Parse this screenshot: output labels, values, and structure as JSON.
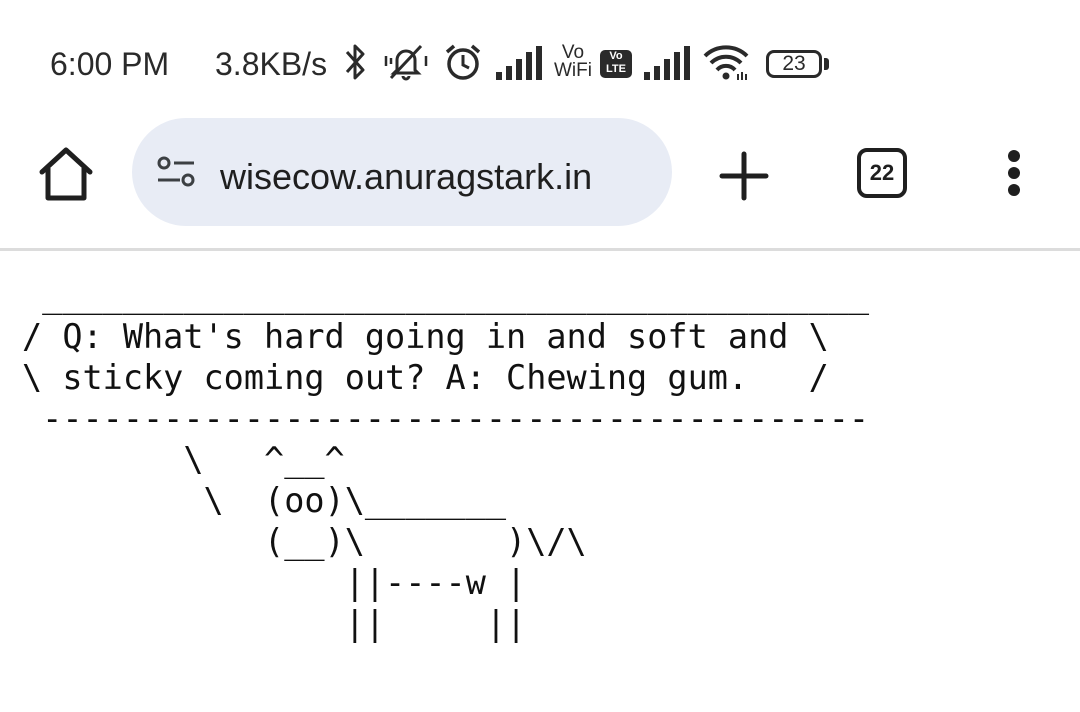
{
  "status_bar": {
    "time": "6:00 PM",
    "network_speed": "3.8KB/s",
    "icons": [
      "bluetooth-icon",
      "muted-bell-icon",
      "alarm-icon",
      "signal-icon",
      "vo-wifi-icon",
      "vo-lte-icon",
      "signal-icon",
      "wifi-icon"
    ],
    "vo_wifi_top": "Vo",
    "vo_wifi_bottom": "WiFi",
    "vo_lte_top": "Vo",
    "vo_lte_bottom": "LTE",
    "battery_level": "23"
  },
  "toolbar": {
    "url": "wisecow.anuragstark.in",
    "tab_count": "22",
    "icons": [
      "home-icon",
      "site-settings-icon",
      "plus-icon",
      "more-vert-icon"
    ]
  },
  "page": {
    "cowsay_text": " _________________________________________\n/ Q: What's hard going in and soft and \\\n\\ sticky coming out? A: Chewing gum.   /\n -----------------------------------------\n        \\   ^__^\n         \\  (oo)\\_______\n            (__)\\       )\\/\\\n                ||----w |\n                ||     ||"
  },
  "colors": {
    "url_bar_bg": "#e8ecf5",
    "text": "#1f1f1f",
    "divider": "#dcdcdc"
  }
}
